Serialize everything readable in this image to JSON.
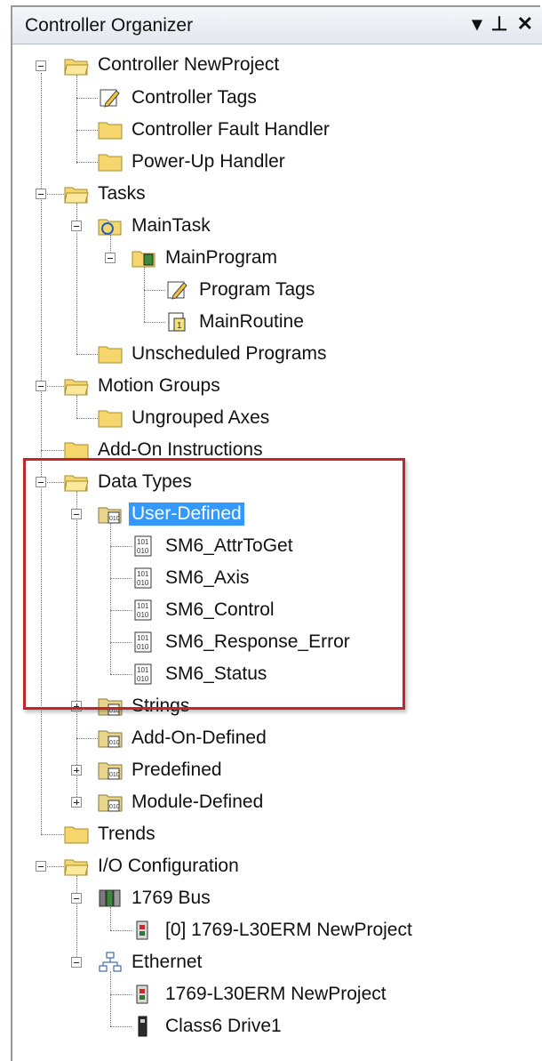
{
  "panel": {
    "title": "Controller Organizer",
    "title_icons": [
      "▾",
      "⊥",
      "✕"
    ]
  },
  "tree": {
    "controller": "Controller NewProject",
    "controller_tags": "Controller Tags",
    "fault_handler": "Controller Fault Handler",
    "powerup_handler": "Power-Up Handler",
    "tasks": "Tasks",
    "main_task": "MainTask",
    "main_program": "MainProgram",
    "program_tags": "Program Tags",
    "main_routine": "MainRoutine",
    "unscheduled": "Unscheduled Programs",
    "motion_groups": "Motion Groups",
    "ungrouped_axes": "Ungrouped Axes",
    "addon_instructions": "Add-On Instructions",
    "data_types": "Data Types",
    "user_defined": "User-Defined",
    "sm6_attr": "SM6_AttrToGet",
    "sm6_axis": "SM6_Axis",
    "sm6_control": "SM6_Control",
    "sm6_response": "SM6_Response_Error",
    "sm6_status": "SM6_Status",
    "strings": "Strings",
    "addon_defined": "Add-On-Defined",
    "predefined": "Predefined",
    "module_defined": "Module-Defined",
    "trends": "Trends",
    "io_config": "I/O Configuration",
    "bus": "1769 Bus",
    "bus_module": "[0] 1769-L30ERM NewProject",
    "ethernet": "Ethernet",
    "eth_module": "1769-L30ERM NewProject",
    "drive": "Class6 Drive1"
  },
  "colors": {
    "highlight_box": "#c0272d",
    "selection": "#3399ff"
  }
}
